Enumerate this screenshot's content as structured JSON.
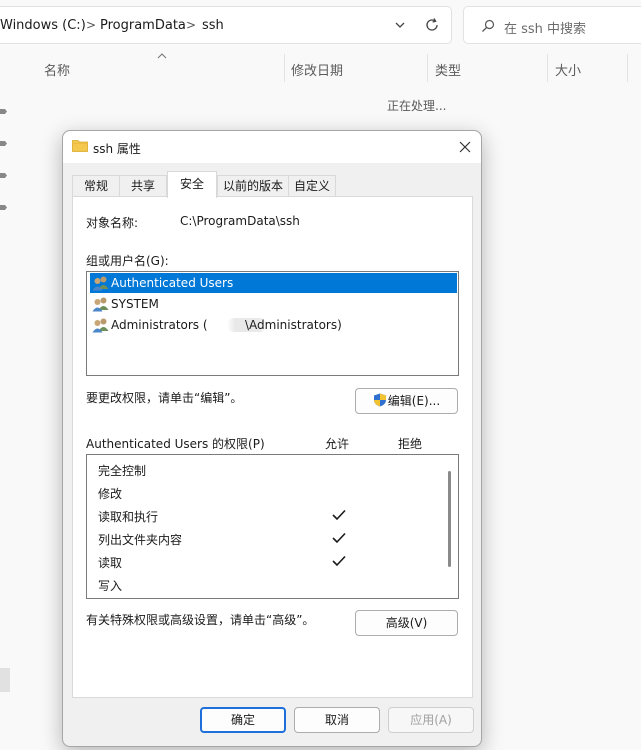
{
  "explorer": {
    "breadcrumbs": [
      "Windows (C:)",
      "ProgramData",
      "ssh"
    ],
    "breadcrumb_separator": ">",
    "search_placeholder": "在 ssh 中搜索",
    "columns": [
      "名称",
      "修改日期",
      "类型",
      "大小"
    ],
    "status_text": "正在处理..."
  },
  "dialog": {
    "title": "ssh 属性",
    "tabs": [
      {
        "label": "常规",
        "active": false
      },
      {
        "label": "共享",
        "active": false
      },
      {
        "label": "安全",
        "active": true
      },
      {
        "label": "以前的版本",
        "active": false
      },
      {
        "label": "自定义",
        "active": false
      }
    ],
    "object_name_label": "对象名称:",
    "object_name_value": "C:\\ProgramData\\ssh",
    "group_label": "组或用户名(G):",
    "users": [
      {
        "label": "Authenticated Users",
        "selected": true
      },
      {
        "label": "SYSTEM",
        "selected": false
      },
      {
        "label": "Administrators (",
        "suffix": "\\Administrators)",
        "selected": false
      }
    ],
    "change_hint": "要更改权限，请单击“编辑”。",
    "edit_button": "编辑(E)...",
    "perm_header": "Authenticated Users 的权限(P)",
    "allow_header": "允许",
    "deny_header": "拒绝",
    "permissions": [
      {
        "name": "完全控制",
        "allow": false,
        "deny": false
      },
      {
        "name": "修改",
        "allow": false,
        "deny": false
      },
      {
        "name": "读取和执行",
        "allow": true,
        "deny": false
      },
      {
        "name": "列出文件夹内容",
        "allow": true,
        "deny": false
      },
      {
        "name": "读取",
        "allow": true,
        "deny": false
      },
      {
        "name": "写入",
        "allow": false,
        "deny": false
      }
    ],
    "advanced_hint": "有关特殊权限或高级设置，请单击“高级”。",
    "advanced_button": "高级(V)",
    "ok_button": "确定",
    "cancel_button": "取消",
    "apply_button": "应用(A)"
  },
  "colors": {
    "selection": "#0078d7",
    "primary_border": "#1e6fd9",
    "folder": "#f4c74f"
  }
}
